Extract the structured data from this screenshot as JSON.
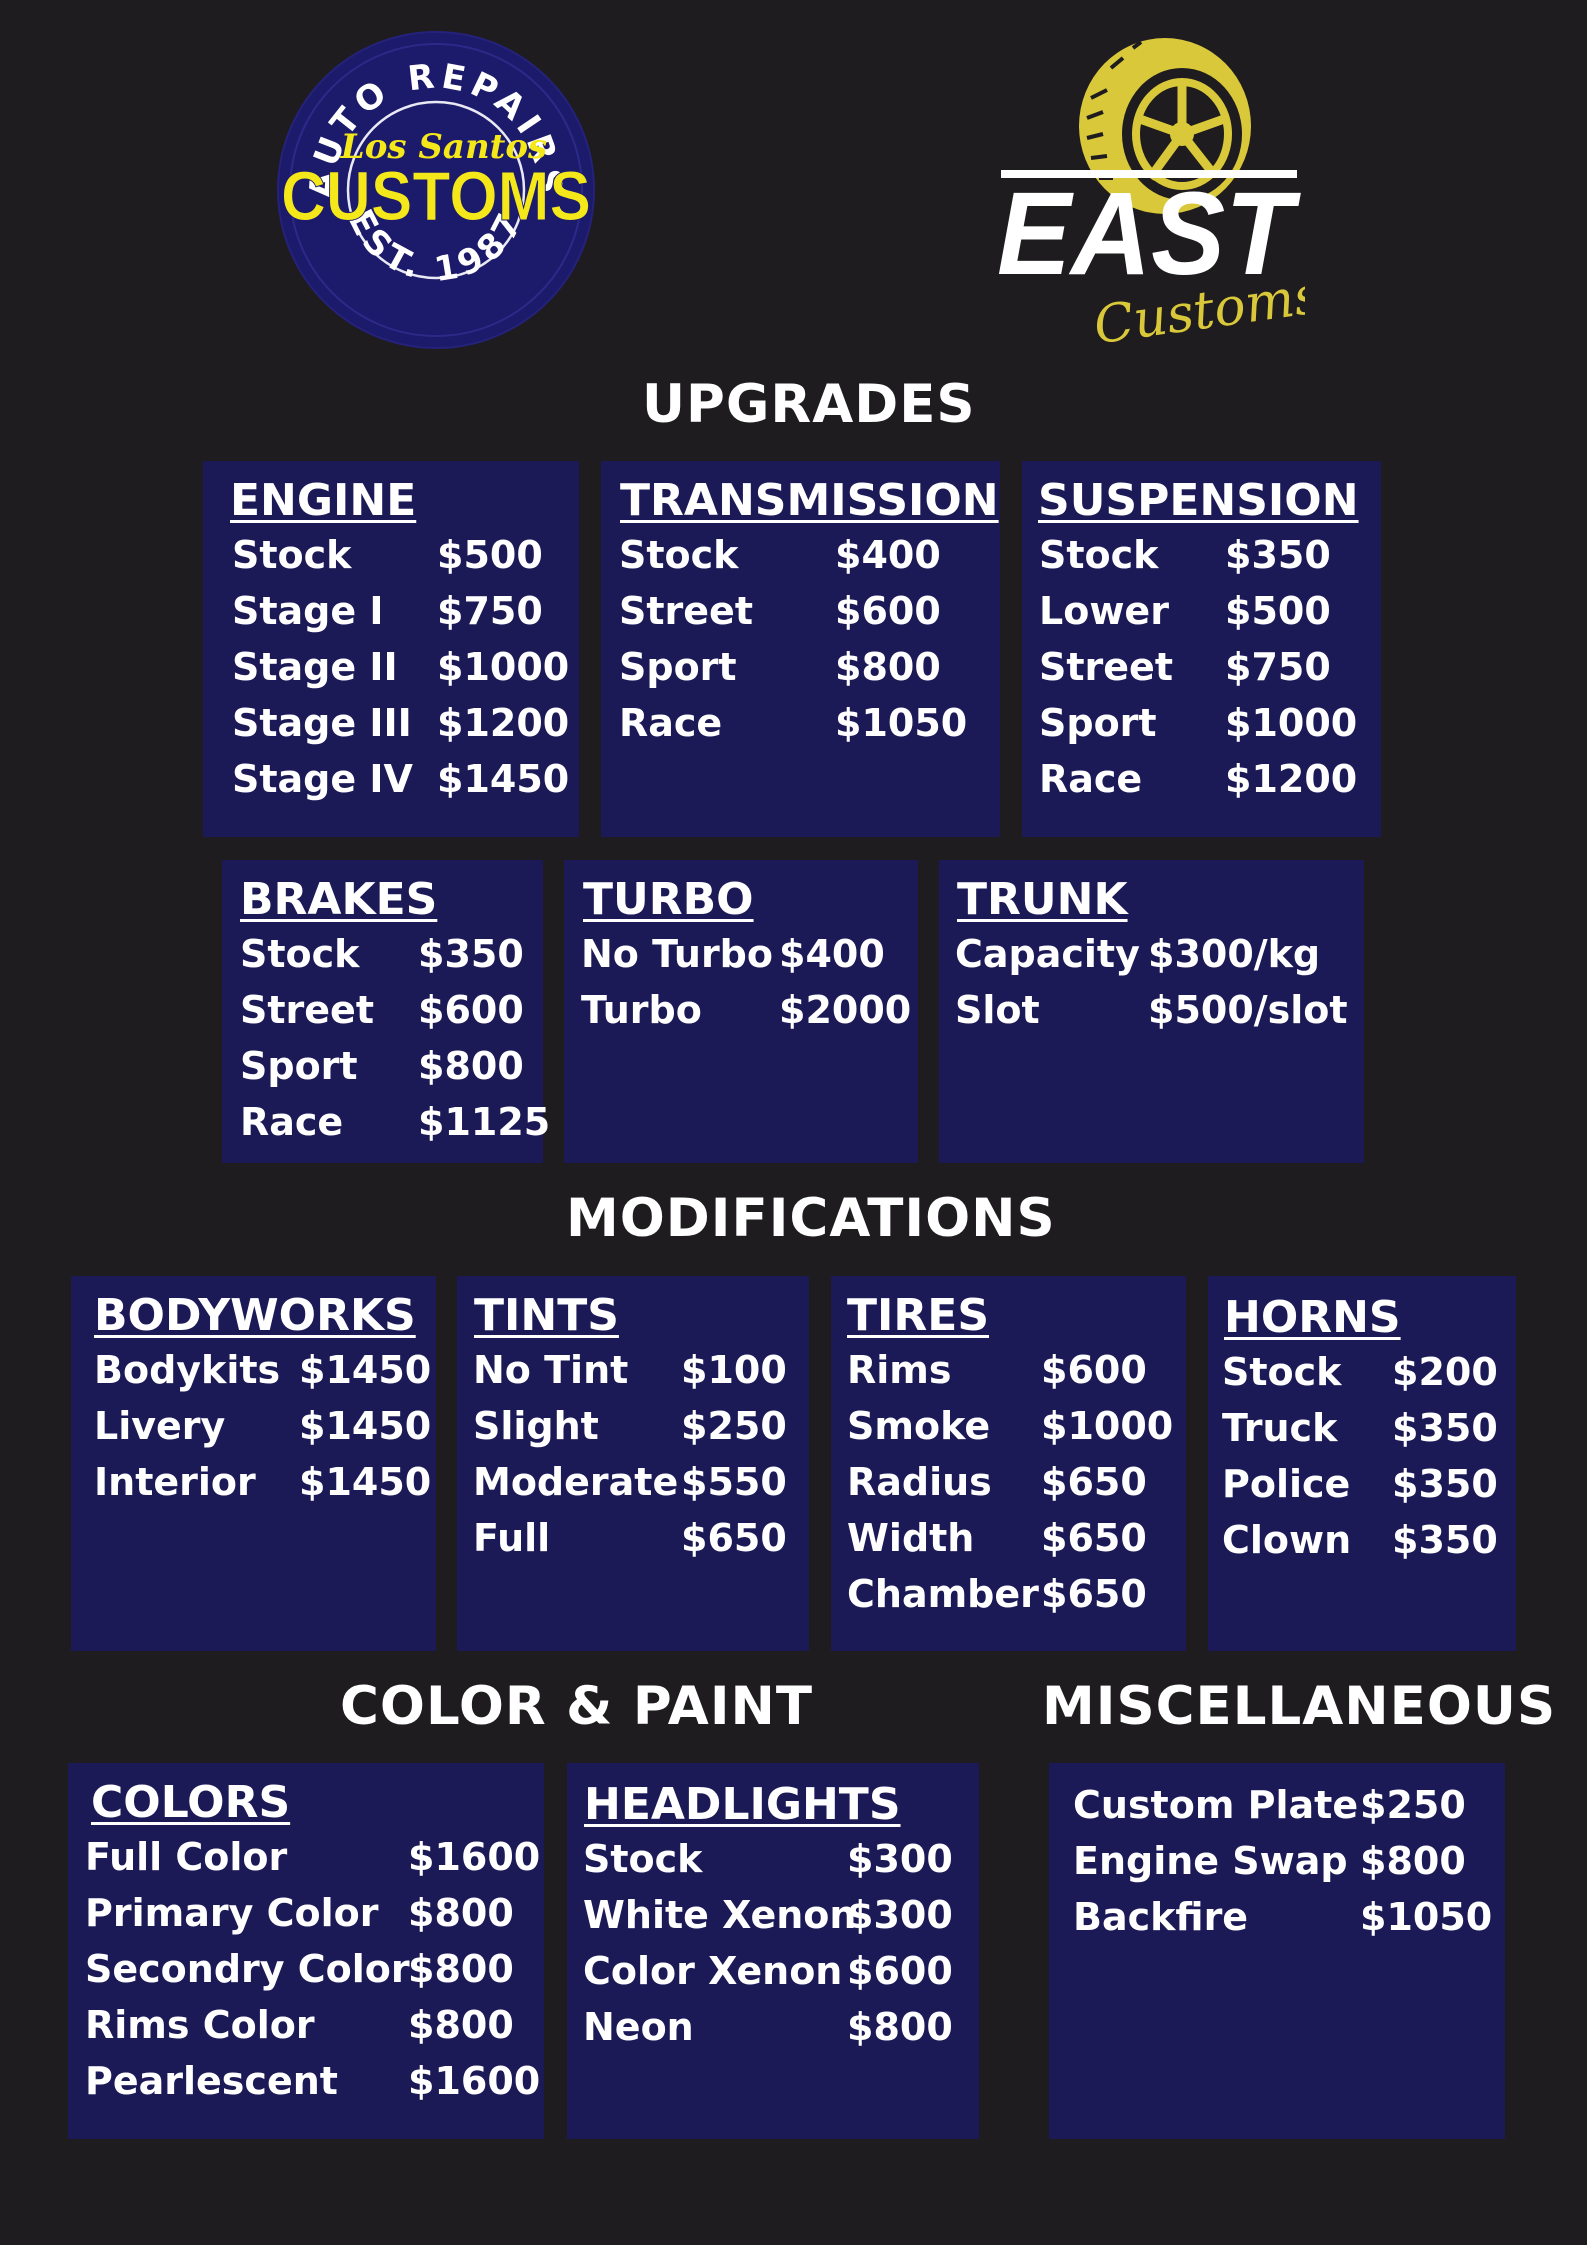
{
  "logos": {
    "left": {
      "ring_top": "AUTO REPAIRS",
      "script": "Los Santos",
      "wordmark": "CUSTOMS",
      "ring_bottom": "EST. 1987",
      "colors": {
        "disc": "#1c1a6b",
        "ring": "#ffffff",
        "text": "#f5e81a"
      }
    },
    "right": {
      "wordmark": "EAST",
      "script": "Customs",
      "icon": "wheel-icon",
      "colors": {
        "wordmark": "#ffffff",
        "accent": "#d9c83a"
      }
    }
  },
  "sections": {
    "upgrades": "UPGRADES",
    "modifications": "MODIFICATIONS",
    "color_paint": "COLOR & PAINT",
    "misc": "MISCELLANEOUS"
  },
  "panels": {
    "engine": {
      "title": "ENGINE",
      "items": [
        {
          "label": "Stock",
          "price": "$500"
        },
        {
          "label": "Stage I",
          "price": "$750"
        },
        {
          "label": "Stage II",
          "price": "$1000"
        },
        {
          "label": "Stage III",
          "price": "$1200"
        },
        {
          "label": "Stage IV",
          "price": "$1450"
        }
      ]
    },
    "transmission": {
      "title": "TRANSMISSION",
      "items": [
        {
          "label": "Stock",
          "price": "$400"
        },
        {
          "label": "Street",
          "price": "$600"
        },
        {
          "label": "Sport",
          "price": "$800"
        },
        {
          "label": "Race",
          "price": "$1050"
        }
      ]
    },
    "suspension": {
      "title": "SUSPENSION",
      "items": [
        {
          "label": "Stock",
          "price": "$350"
        },
        {
          "label": "Lower",
          "price": "$500"
        },
        {
          "label": "Street",
          "price": "$750"
        },
        {
          "label": "Sport",
          "price": "$1000"
        },
        {
          "label": "Race",
          "price": "$1200"
        }
      ]
    },
    "brakes": {
      "title": "BRAKES",
      "items": [
        {
          "label": "Stock",
          "price": "$350"
        },
        {
          "label": "Street",
          "price": "$600"
        },
        {
          "label": "Sport",
          "price": "$800"
        },
        {
          "label": "Race",
          "price": "$1125"
        }
      ]
    },
    "turbo": {
      "title": "TURBO",
      "items": [
        {
          "label": "No Turbo",
          "price": "$400"
        },
        {
          "label": "Turbo",
          "price": "$2000"
        }
      ]
    },
    "trunk": {
      "title": "TRUNK",
      "items": [
        {
          "label": "Capacity",
          "price": "$300/kg"
        },
        {
          "label": "Slot",
          "price": "$500/slot"
        }
      ]
    },
    "bodyworks": {
      "title": "BODYWORKS",
      "items": [
        {
          "label": "Bodykits",
          "price": "$1450"
        },
        {
          "label": "Livery",
          "price": "$1450"
        },
        {
          "label": "Interior",
          "price": "$1450"
        }
      ]
    },
    "tints": {
      "title": "TINTS",
      "items": [
        {
          "label": "No Tint",
          "price": "$100"
        },
        {
          "label": "Slight",
          "price": "$250"
        },
        {
          "label": "Moderate",
          "price": "$550"
        },
        {
          "label": "Full",
          "price": "$650"
        }
      ]
    },
    "tires": {
      "title": "TIRES",
      "items": [
        {
          "label": "Rims",
          "price": "$600"
        },
        {
          "label": "Smoke",
          "price": "$1000"
        },
        {
          "label": "Radius",
          "price": "$650"
        },
        {
          "label": "Width",
          "price": "$650"
        },
        {
          "label": "Chamber",
          "price": "$650"
        }
      ]
    },
    "horns": {
      "title": "HORNS",
      "items": [
        {
          "label": "Stock",
          "price": "$200"
        },
        {
          "label": "Truck",
          "price": "$350"
        },
        {
          "label": "Police",
          "price": "$350"
        },
        {
          "label": "Clown",
          "price": "$350"
        }
      ]
    },
    "colors": {
      "title": "COLORS",
      "items": [
        {
          "label": "Full Color",
          "price": "$1600"
        },
        {
          "label": "Primary Color",
          "price": "$800"
        },
        {
          "label": "Secondry Color",
          "price": "$800"
        },
        {
          "label": "Rims Color",
          "price": "$800"
        },
        {
          "label": "Pearlescent",
          "price": "$1600"
        }
      ]
    },
    "headlights": {
      "title": "HEADLIGHTS",
      "items": [
        {
          "label": "Stock",
          "price": "$300"
        },
        {
          "label": "White Xenon",
          "price": "$300"
        },
        {
          "label": "Color Xenon",
          "price": "$600"
        },
        {
          "label": "Neon",
          "price": "$800"
        }
      ]
    },
    "misc": {
      "title": "",
      "items": [
        {
          "label": "Custom Plate",
          "price": "$250"
        },
        {
          "label": "Engine Swap",
          "price": "$800"
        },
        {
          "label": "Backfire",
          "price": "$1050"
        }
      ]
    }
  },
  "colors": {
    "background": "#1e1c1f",
    "panel": "#1c1957",
    "text": "#ffffff"
  }
}
